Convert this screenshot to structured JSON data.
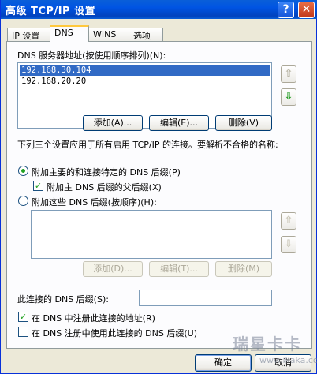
{
  "title_bar": {
    "title": "高级 TCP/IP 设置",
    "help": "?",
    "close": "✕"
  },
  "tabs": [
    {
      "label": "IP 设置"
    },
    {
      "label": "DNS"
    },
    {
      "label": "WINS"
    },
    {
      "label": "选项"
    }
  ],
  "dns_servers": {
    "label": "DNS 服务器地址(按使用顺序排列)(N):",
    "items": [
      "192.168.30.104",
      "192.168.20.20"
    ],
    "selected_index": 0
  },
  "server_buttons": {
    "add": "添加(A)...",
    "edit": "编辑(E)...",
    "remove": "删除(V)"
  },
  "arrows": {
    "up": "⇧",
    "down": "⇩"
  },
  "description": "下列三个设置应用于所有启用 TCP/IP 的连接。要解析不合格的名称:",
  "radio_primary": {
    "label": "附加主要的和连接特定的 DNS 后缀(P)",
    "checked": true
  },
  "checkbox_parent": {
    "label": "附加主 DNS 后缀的父后缀(X)",
    "checked": true,
    "mark": "✓"
  },
  "radio_these": {
    "label": "附加这些 DNS 后缀(按顺序)(H):",
    "checked": false
  },
  "suffix_buttons": {
    "add": "添加(D)...",
    "edit": "编辑(T)...",
    "remove": "删除(M)"
  },
  "connection_suffix": {
    "label": "此连接的 DNS 后缀(S):",
    "value": ""
  },
  "checkbox_register": {
    "label": "在 DNS 中注册此连接的地址(R)",
    "checked": true,
    "mark": "✓"
  },
  "checkbox_use_suffix": {
    "label": "在 DNS 注册中使用此连接的 DNS 后缀(U)",
    "checked": false
  },
  "footer": {
    "ok": "确定",
    "cancel": "取消"
  },
  "watermark": {
    "text": "瑞星卡卡",
    "sub": "www.ikaka.com"
  }
}
